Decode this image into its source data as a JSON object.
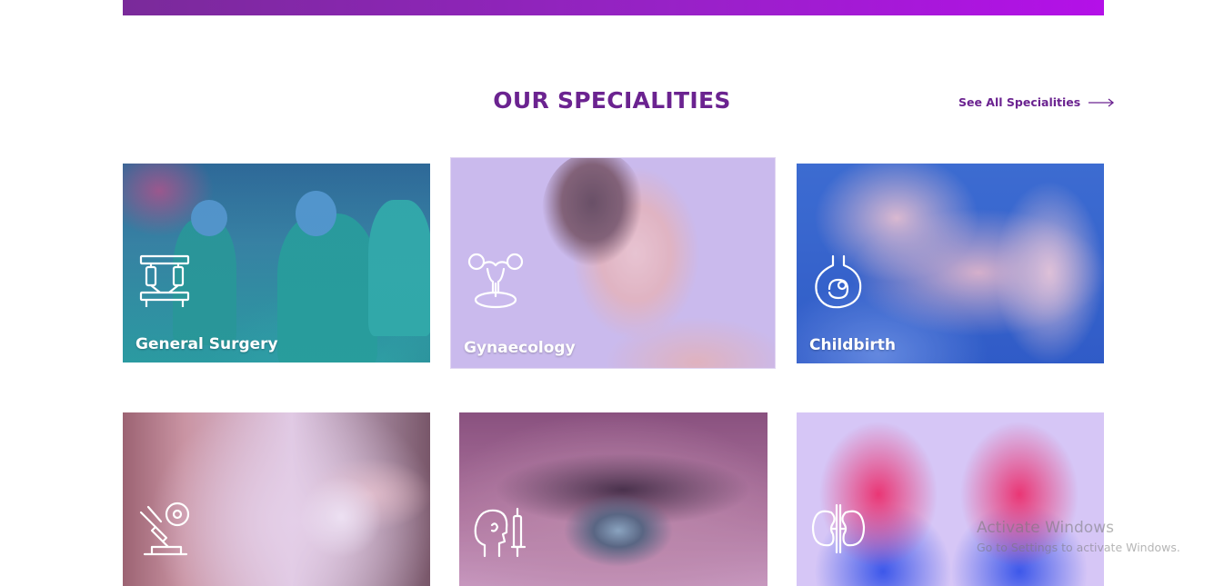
{
  "section": {
    "title": "OUR SPECIALITIES",
    "see_all_label": "See All Specialities"
  },
  "cards": [
    {
      "label": "General Surgery",
      "icon": "surgery-robot-icon"
    },
    {
      "label": "Gynaecology",
      "icon": "uterus-icon"
    },
    {
      "label": "Childbirth",
      "icon": "fetus-womb-icon"
    },
    {
      "label": "",
      "icon": "microscope-lab-icon"
    },
    {
      "label": "",
      "icon": "head-ent-icon"
    },
    {
      "label": "",
      "icon": "kidneys-icon"
    }
  ],
  "watermark": {
    "title": "Activate Windows",
    "subtitle": "Go to Settings to activate Windows."
  },
  "colors": {
    "brand_purple": "#6b2390",
    "banner_gradient_end": "#b410e8"
  }
}
